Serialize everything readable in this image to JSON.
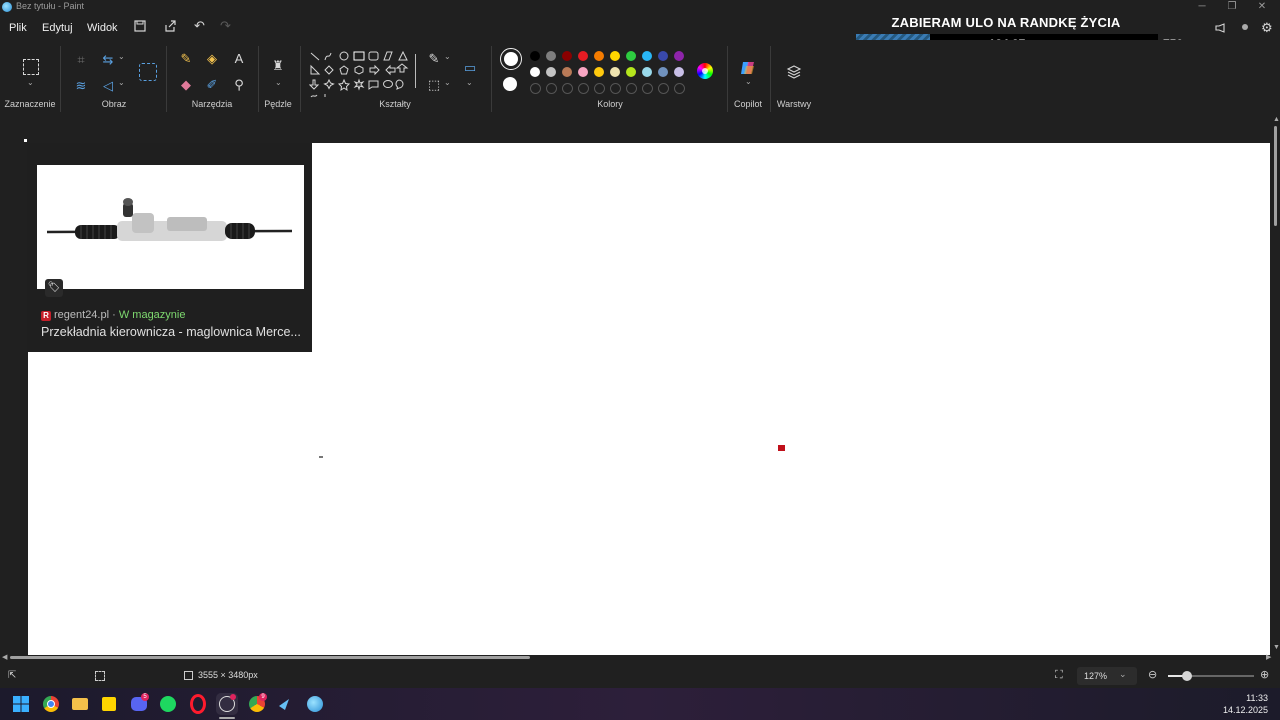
{
  "window": {
    "title": "Bez tytułu - Paint"
  },
  "menu": {
    "items": [
      "Plik",
      "Edytuj",
      "Widok"
    ]
  },
  "ribbon": {
    "groups": {
      "selection": "Zaznaczenie",
      "image": "Obraz",
      "tools": "Narzędzia",
      "brushes": "Pędzle",
      "shapes": "Kształty",
      "colors": "Kolory",
      "copilot": "Copilot",
      "layers": "Warstwy"
    },
    "palette_row1": [
      "#000000",
      "#7f7f7f",
      "#8b0000",
      "#e51c23",
      "#f57c00",
      "#ffd600",
      "#2ecc40",
      "#29b6f6",
      "#3949ab",
      "#8e24aa"
    ],
    "palette_row2": [
      "#ffffff",
      "#c3c3c3",
      "#b97a57",
      "#f8a5c2",
      "#ffc90e",
      "#efe4b0",
      "#b5e61d",
      "#99d9ea",
      "#7092be",
      "#c8bfe7"
    ]
  },
  "overlay": {
    "title": "ZABIERAM ULO NA RANDKĘ ŻYCIA",
    "progress_value": "184.37",
    "target": "750",
    "progress_fraction": 0.2458
  },
  "thumbnail": {
    "source": "regent24.pl",
    "separator": "·",
    "stock": "W magazynie",
    "caption": "Przekładnia kierownicza - maglownica Merce..."
  },
  "status": {
    "canvas_size": "3555 × 3480px",
    "zoom": "127%",
    "zoom_fraction": 0.22
  },
  "taskbar": {
    "time": "11:33",
    "date": "14.12.2025",
    "discord_badge": "5",
    "chrome_badge": "9"
  }
}
